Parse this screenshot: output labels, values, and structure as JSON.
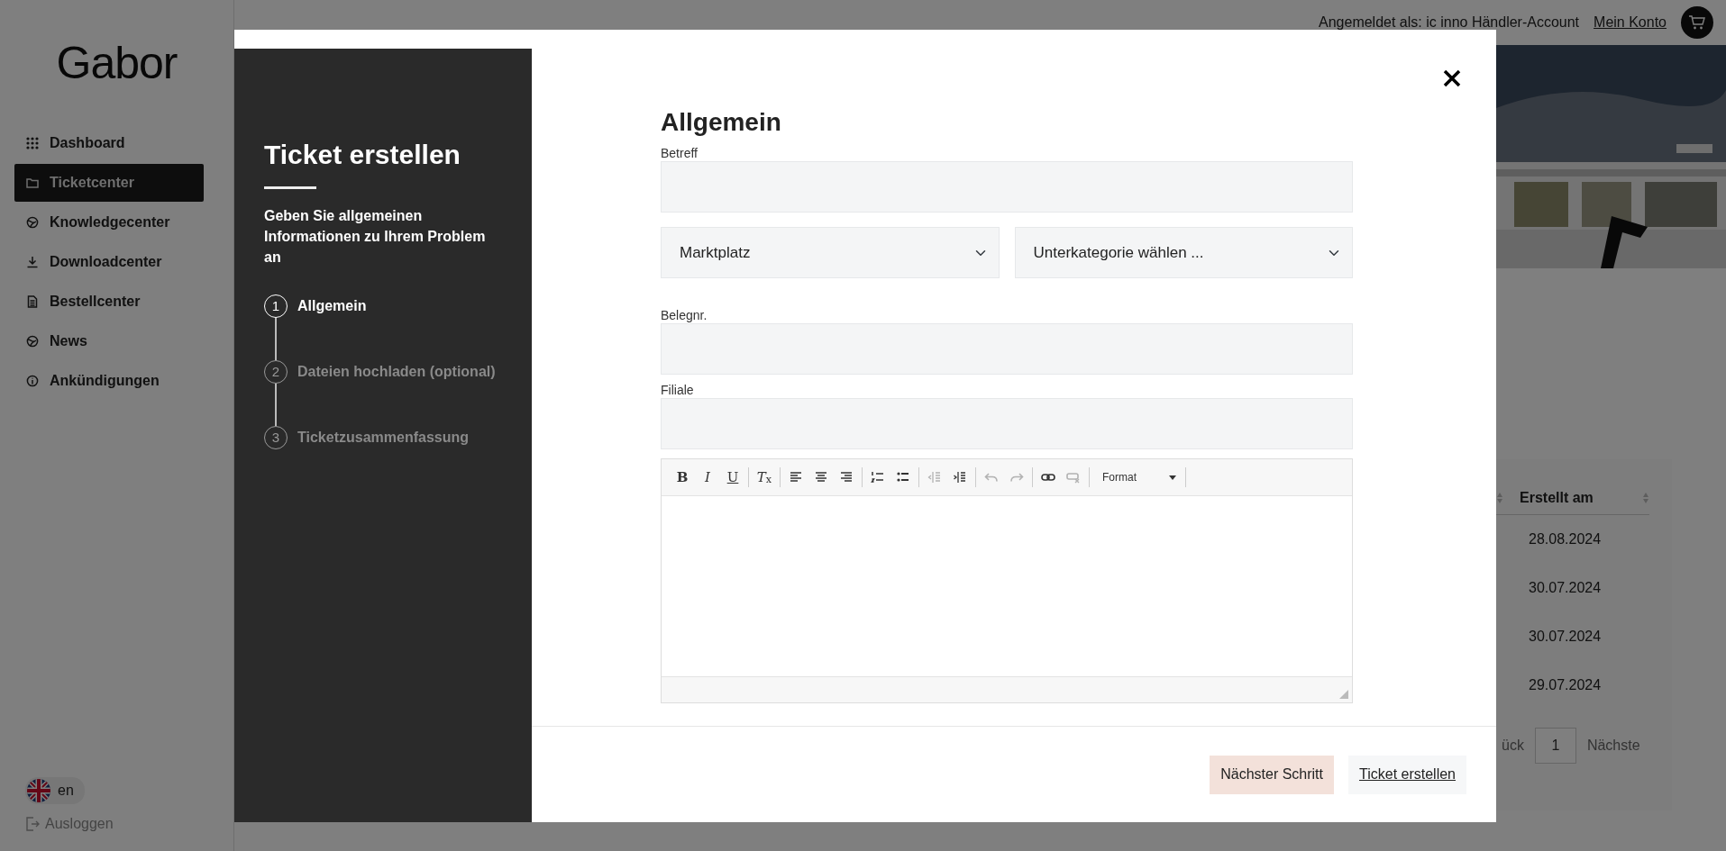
{
  "sidebar": {
    "logo": "Gabor",
    "items": [
      {
        "label": "Dashboard",
        "selected": false
      },
      {
        "label": "Ticketcenter",
        "selected": true
      },
      {
        "label": "Knowledgecenter",
        "selected": false
      },
      {
        "label": "Downloadcenter",
        "selected": false
      },
      {
        "label": "Bestellcenter",
        "selected": false
      },
      {
        "label": "News",
        "selected": false
      },
      {
        "label": "Ankündigungen",
        "selected": false
      }
    ],
    "language": "en",
    "logout": "Ausloggen"
  },
  "header": {
    "user": "Angemeldet als: ic inno Händler-Account",
    "account_link": "Mein Konto"
  },
  "table": {
    "columns": [
      "Erstellt am"
    ],
    "rows": [
      [
        "28.08.2024"
      ],
      [
        "30.07.2024"
      ],
      [
        "30.07.2024"
      ],
      [
        "29.07.2024"
      ]
    ]
  },
  "pagination": {
    "previous": "ück",
    "page": "1",
    "next": "Nächste"
  },
  "modal": {
    "title": "Ticket erstellen",
    "description": "Geben Sie allgemeinen Informationen zu Ihrem Problem an",
    "steps": [
      {
        "number": "1",
        "label": "Allgemein",
        "current": true
      },
      {
        "number": "2",
        "label": "Dateien hochladen (optional)",
        "current": false
      },
      {
        "number": "3",
        "label": "Ticketzusammenfassung",
        "current": false
      }
    ],
    "section_title": "Allgemein",
    "fields": [
      {
        "kind": "input",
        "label": "Betreff"
      },
      {
        "kind": "selects",
        "values": [
          "Marktplatz",
          "Unterkategorie wählen ..."
        ]
      },
      {
        "kind": "input",
        "label": "Belegnr."
      },
      {
        "kind": "input",
        "label": "Filiale"
      }
    ],
    "toolbar": [
      {
        "kind": "text",
        "label": "**B**",
        "disabled": false
      },
      {
        "kind": "text",
        "label": "*I*",
        "disabled": false
      },
      {
        "kind": "text",
        "label": "U",
        "disabled": false
      },
      {
        "kind": "separator"
      },
      {
        "kind": "text",
        "label": "*T*$_{x}$",
        "disabled": false
      },
      {
        "kind": "separator"
      },
      {
        "kind": "icon",
        "disabled": false
      },
      {
        "kind": "icon",
        "disabled": false
      },
      {
        "kind": "icon",
        "disabled": false
      },
      {
        "kind": "separator"
      },
      {
        "kind": "icon",
        "disabled": false
      },
      {
        "kind": "icon",
        "disabled": false
      },
      {
        "kind": "separator"
      },
      {
        "kind": "icon",
        "disabled": true
      },
      {
        "kind": "icon",
        "disabled": false
      },
      {
        "kind": "separator"
      },
      {
        "kind": "icon",
        "disabled": true
      },
      {
        "kind": "icon",
        "disabled": true
      },
      {
        "kind": "separator"
      },
      {
        "kind": "icon",
        "disabled": false
      },
      {
        "kind": "icon",
        "disabled": true
      },
      {
        "kind": "separator"
      },
      {
        "kind": "dropdown",
        "label": "Format"
      },
      {
        "kind": "separator"
      }
    ],
    "buttons": [
      {
        "kind": "primary",
        "label": "Nächster Schritt"
      },
      {
        "kind": "secondary",
        "label": "Ticket erstellen"
      }
    ]
  }
}
